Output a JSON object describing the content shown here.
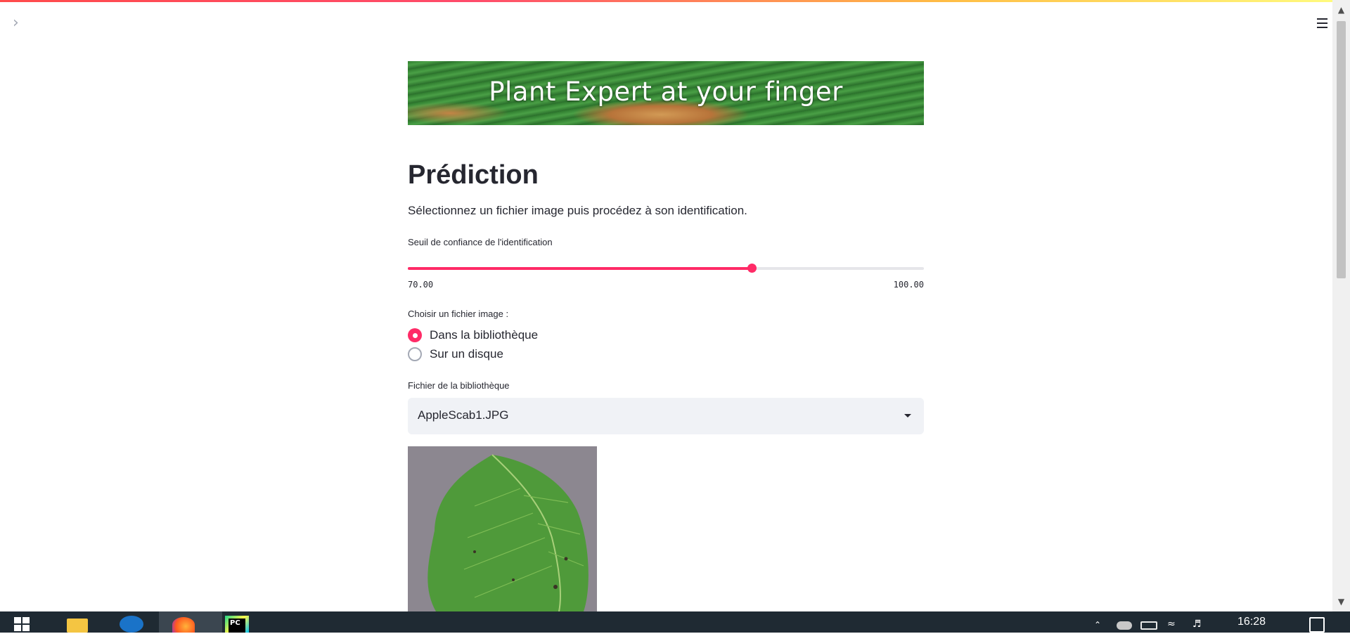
{
  "app": {
    "banner_title": "Plant Expert at your finger",
    "page_title": "Prédiction",
    "intro_text": "Sélectionnez un fichier image puis procédez à son identification.",
    "accent_color": "#ff2b67"
  },
  "slider": {
    "label": "Seuil de confiance de l'identification",
    "min_label": "70.00",
    "max_label": "100.00",
    "min": 70,
    "max": 100,
    "value": 90
  },
  "source": {
    "label": "Choisir un fichier image :",
    "options": [
      {
        "label": "Dans la bibliothèque",
        "checked": true
      },
      {
        "label": "Sur un disque",
        "checked": false
      }
    ]
  },
  "library": {
    "label": "Fichier de la bibliothèque",
    "selected": "AppleScab1.JPG"
  },
  "icons": {
    "sidebar_toggle": "chevron-right-icon",
    "main_menu": "hamburger-menu-icon",
    "select_caret": "caret-down-icon"
  },
  "taskbar": {
    "clock": "16:28"
  }
}
